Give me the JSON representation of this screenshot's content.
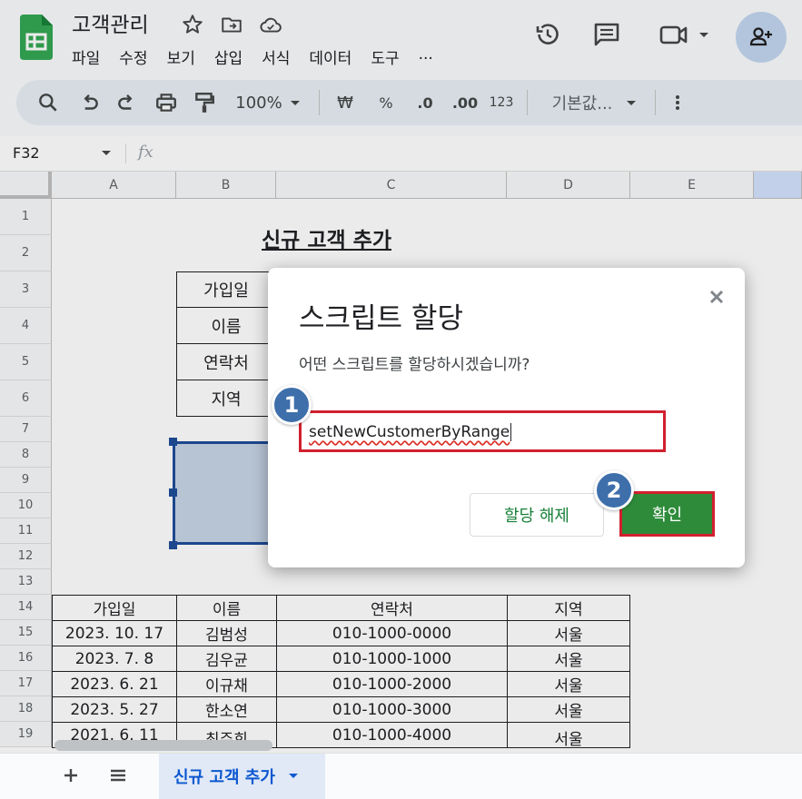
{
  "header": {
    "doc_title": "고객관리",
    "menu": [
      "파일",
      "수정",
      "보기",
      "삽입",
      "서식",
      "데이터",
      "도구",
      "..."
    ],
    "icons": [
      "star-icon",
      "move-to-folder-icon",
      "cloud-saved-icon",
      "version-history-icon",
      "comments-icon",
      "meet-icon",
      "share-person-add-icon"
    ]
  },
  "toolbar": {
    "zoom": "100%",
    "currency": "₩",
    "percent": "%",
    "decrease_decimal": ".0",
    "increase_decimal": ".00",
    "number_format": "123",
    "font": "기본값..."
  },
  "formula_bar": {
    "cell_ref": "F32",
    "fx": "fx",
    "content": ""
  },
  "grid": {
    "columns": [
      "A",
      "B",
      "C",
      "D",
      "E"
    ],
    "rows": [
      "1",
      "2",
      "3",
      "4",
      "5",
      "6",
      "7",
      "8",
      "9",
      "10",
      "11",
      "12",
      "13",
      "14",
      "15",
      "16",
      "17",
      "18",
      "19"
    ],
    "sheet_title": "신규 고객 추가",
    "input_labels": [
      "가입일",
      "이름",
      "연락처",
      "지역"
    ],
    "table_headers": [
      "가입일",
      "이름",
      "연락처",
      "지역"
    ],
    "table_rows": [
      [
        "2023. 10. 17",
        "김범성",
        "010-1000-0000",
        "서울"
      ],
      [
        "2023. 7. 8",
        "김우균",
        "010-1000-1000",
        "서울"
      ],
      [
        "2023. 6. 21",
        "이규채",
        "010-1000-2000",
        "서울"
      ],
      [
        "2023. 5. 27",
        "한소연",
        "010-1000-3000",
        "서울"
      ],
      [
        "2021. 6. 11",
        "최주희",
        "010-1000-4000",
        "서울"
      ]
    ]
  },
  "dialog": {
    "title": "스크립트 할당",
    "question": "어떤 스크립트를 할당하시겠습니까?",
    "script_value": "setNewCustomerByRange",
    "unassign_label": "할당 해제",
    "ok_label": "확인",
    "step_badges": [
      "1",
      "2"
    ]
  },
  "sheet_tabs": {
    "active": "신규 고객 추가"
  },
  "colors": {
    "accent_blue": "#0b57d0",
    "ok_green": "#2e8b3a",
    "highlight_red": "#d1202e",
    "badge_blue": "#3e6fab"
  }
}
